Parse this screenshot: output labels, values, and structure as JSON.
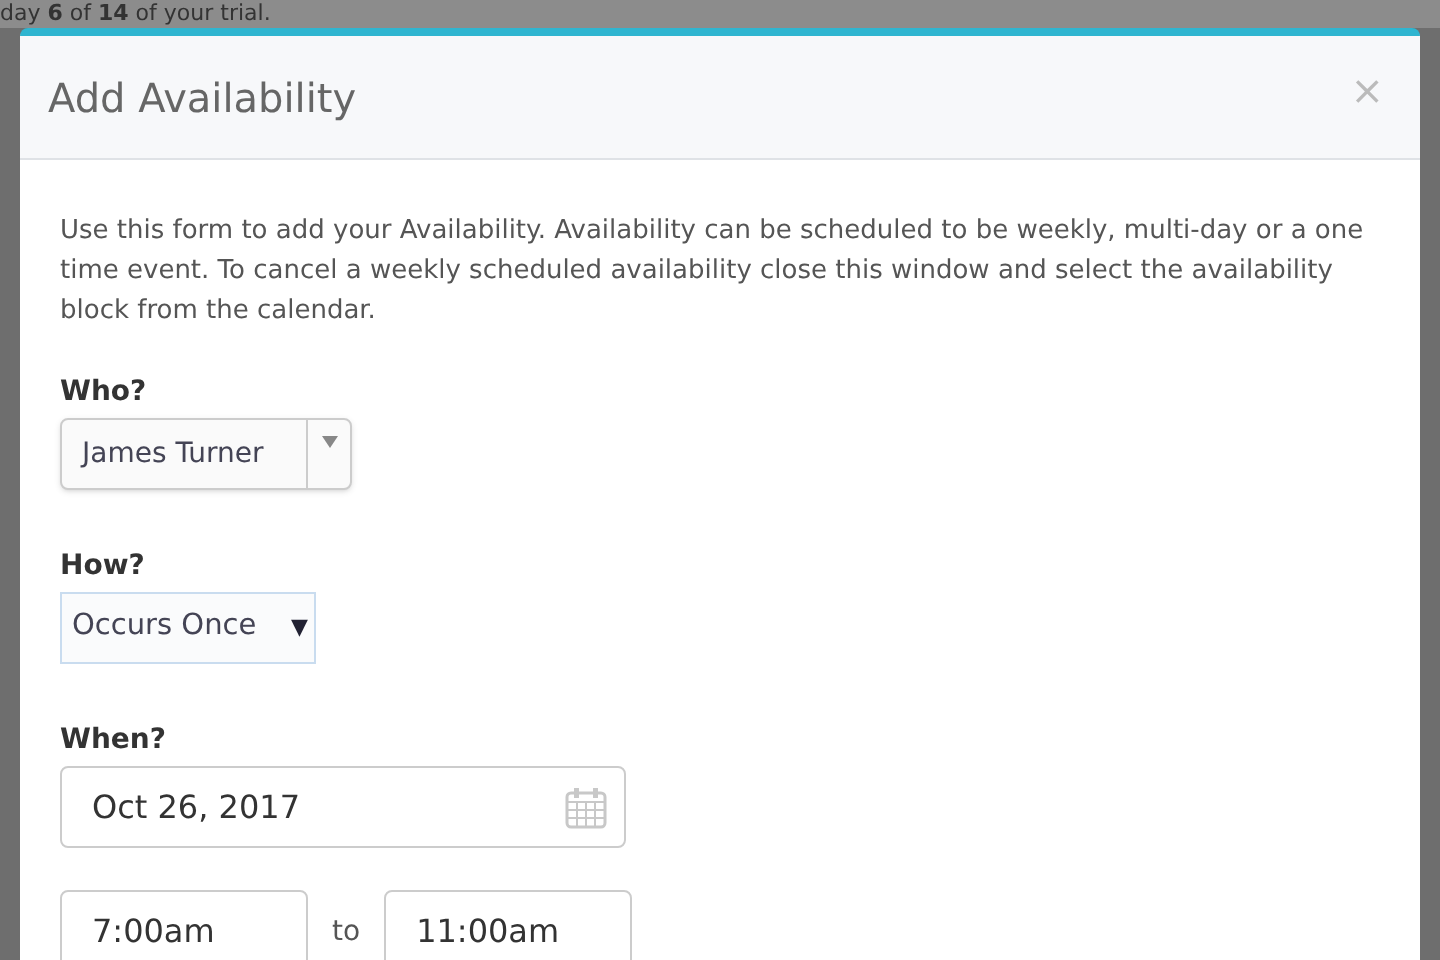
{
  "background": {
    "banner": "day **6** of **14** of your trial."
  },
  "modal": {
    "title": "Add Availability",
    "close": "×",
    "intro": "Use this form to add your Availability. Availability can be scheduled to be weekly, multi-day or a one time event. To cancel a weekly scheduled availability close this window and select the availability block from the calendar.",
    "who": {
      "label": "Who?",
      "value": "James Turner"
    },
    "how": {
      "label": "How?",
      "value": "Occurs Once",
      "caret": "▼"
    },
    "when": {
      "label": "When?",
      "date": "Oct 26, 2017",
      "start": "7:00am",
      "separator": "to",
      "end": "11:00am"
    }
  }
}
